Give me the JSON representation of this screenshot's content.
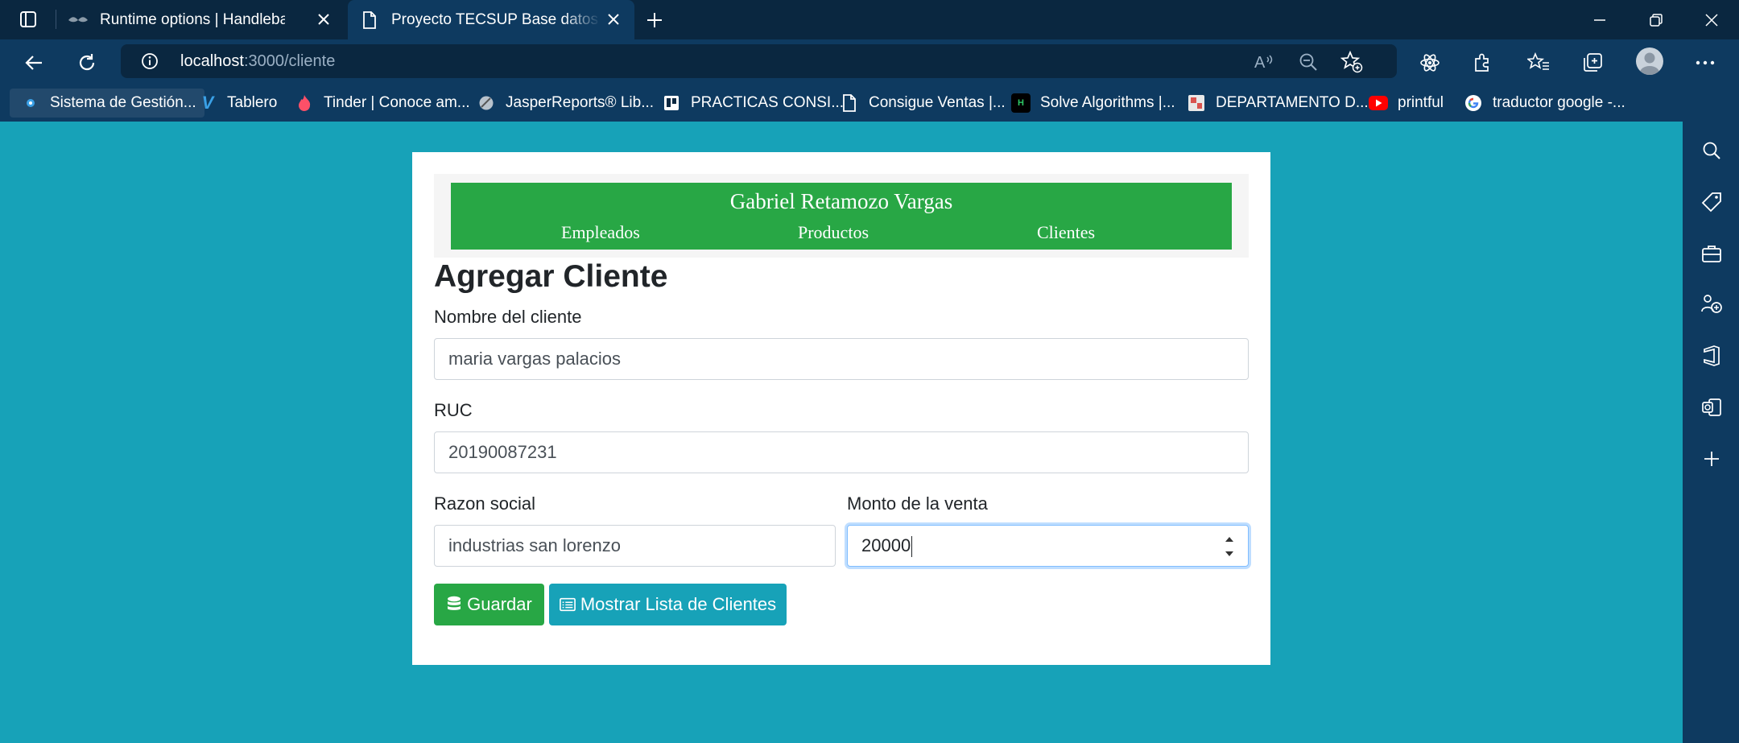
{
  "browser": {
    "tabs": [
      {
        "title": "Runtime options | Handlebars",
        "icon": "handlebars-icon",
        "active": false
      },
      {
        "title": "Proyecto TECSUP Base datos avanzado",
        "icon": "page-icon",
        "active": true
      }
    ],
    "url": {
      "host": "localhost",
      "path": ":3000/cliente"
    },
    "bookmarks": [
      {
        "label": "Sistema de Gestión...",
        "icon": "gestion-icon"
      },
      {
        "label": "Tablero",
        "icon": "vimeo-icon"
      },
      {
        "label": "Tinder | Conoce am...",
        "icon": "tinder-icon"
      },
      {
        "label": "JasperReports® Lib...",
        "icon": "jasper-icon"
      },
      {
        "label": "PRACTICAS CONSI...",
        "icon": "trello-icon"
      },
      {
        "label": "Consigue Ventas |...",
        "icon": "page-icon"
      },
      {
        "label": "Solve Algorithms |...",
        "icon": "hackerrank-icon"
      },
      {
        "label": "DEPARTAMENTO D...",
        "icon": "departamento-icon"
      },
      {
        "label": "printful",
        "icon": "youtube-icon"
      },
      {
        "label": "traductor google -...",
        "icon": "google-icon"
      }
    ]
  },
  "header": {
    "title": "Gabriel Retamozo Vargas",
    "nav": [
      "Empleados",
      "Productos",
      "Clientes"
    ]
  },
  "form": {
    "heading": "Agregar Cliente",
    "nombre_label": "Nombre del cliente",
    "nombre_value": "maria vargas palacios",
    "ruc_label": "RUC",
    "ruc_value": "20190087231",
    "razon_label": "Razon social",
    "razon_value": "industrias san lorenzo",
    "monto_label": "Monto de la venta",
    "monto_value": "20000",
    "save_label": "Guardar",
    "list_label": "Mostrar Lista de Clientes"
  },
  "colors": {
    "page_bg": "#17a2b8",
    "header_green": "#28a745",
    "browser_chrome": "#0e3a60"
  }
}
